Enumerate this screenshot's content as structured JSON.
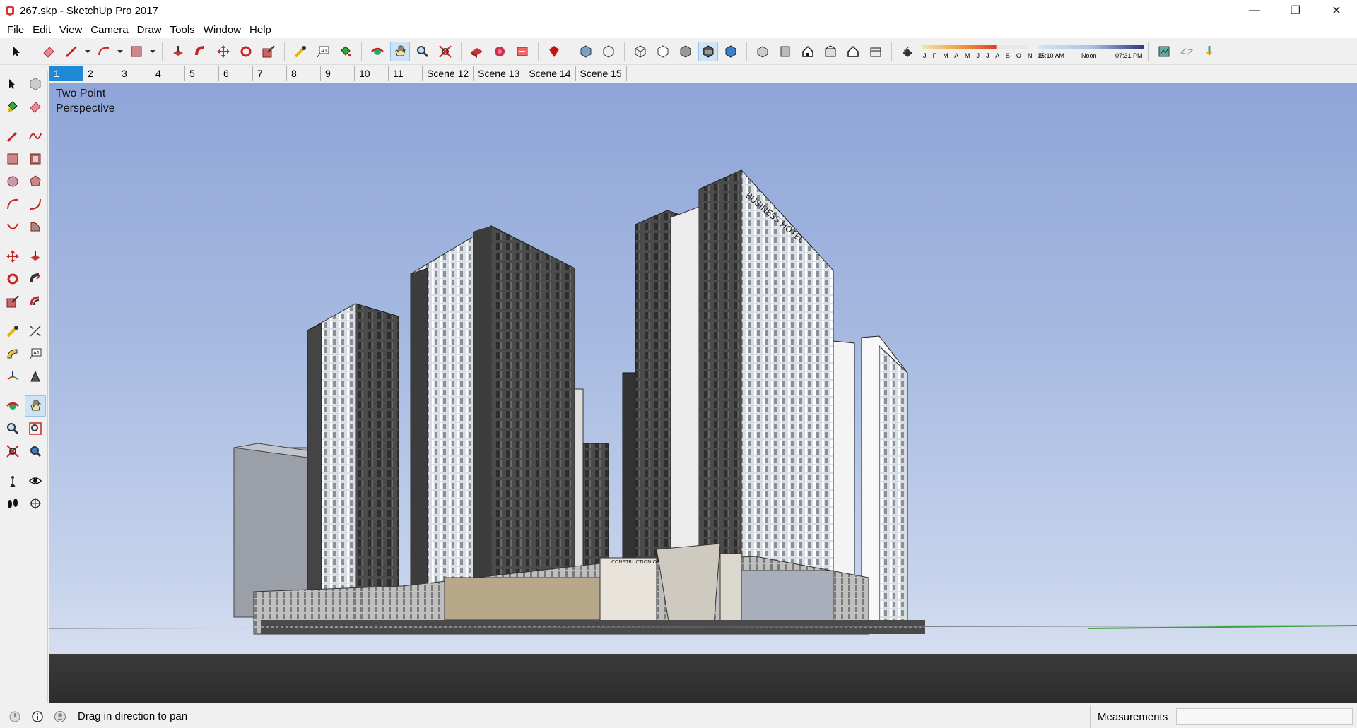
{
  "window": {
    "title": "267.skp - SketchUp Pro 2017",
    "controls": {
      "minimize": "—",
      "restore": "❐",
      "close": "✕"
    }
  },
  "menu": [
    "File",
    "Edit",
    "View",
    "Camera",
    "Draw",
    "Tools",
    "Window",
    "Help"
  ],
  "toolbar": {
    "shadow": {
      "months": "J F M A M J J A S O N D",
      "time_start": "05:10 AM",
      "time_mid": "Noon",
      "time_end": "07:31 PM"
    }
  },
  "scenes": {
    "active_index": 0,
    "tabs": [
      "1",
      "2",
      "3",
      "4",
      "5",
      "6",
      "7",
      "8",
      "9",
      "10",
      "11",
      "Scene 12",
      "Scene 13",
      "Scene 14",
      "Scene 15"
    ]
  },
  "viewport": {
    "camera_label_line1": "Two Point",
    "camera_label_line2": "Perspective",
    "signage_left": "CONSTRUCTION OF",
    "signage_right": "BUSINESS HOTEL"
  },
  "status": {
    "hint": "Drag in direction to pan",
    "measurements_label": "Measurements",
    "measurements_value": ""
  },
  "colors": {
    "accent": "#1e8ad6",
    "sky_top": "#8fa5d8",
    "ground": "#2c2c2c",
    "tower_dark": "#4a4a4a"
  }
}
